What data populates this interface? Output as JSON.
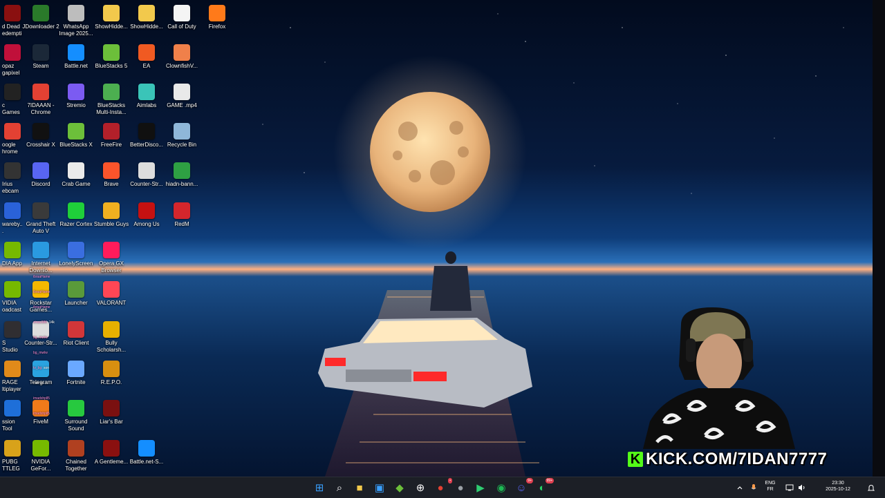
{
  "desktop": {
    "icons": [
      {
        "label": "d Dead edempti...",
        "icon": "rdr-icon",
        "color": "#8a1010"
      },
      {
        "label": "JDownloader 2",
        "icon": "jdownloader-icon",
        "color": "#2a7a2a"
      },
      {
        "label": "WhatsApp Image 2025...",
        "icon": "image-file-icon",
        "color": "#bdbdbd"
      },
      {
        "label": "ShowHidde...",
        "icon": "folder-icon",
        "color": "#f2c94c"
      },
      {
        "label": "ShowHidde...",
        "icon": "folder-icon",
        "color": "#f2c94c"
      },
      {
        "label": "Call of Duty",
        "icon": "file-icon",
        "color": "#f4f4f4"
      },
      {
        "label": "Firefox",
        "icon": "firefox-icon",
        "color": "#ff7a1a"
      },
      {
        "label": "opaz gapixel AI",
        "icon": "topaz-icon",
        "color": "#c0103a"
      },
      {
        "label": "Steam",
        "icon": "steam-icon",
        "color": "#1b2838"
      },
      {
        "label": "Battle.net",
        "icon": "battlenet-icon",
        "color": "#148eff"
      },
      {
        "label": "BlueStacks 5",
        "icon": "bluestacks-icon",
        "color": "#6cbf3a"
      },
      {
        "label": "EA",
        "icon": "ea-icon",
        "color": "#f05a22"
      },
      {
        "label": "ClownfishV...",
        "icon": "clownfish-icon",
        "color": "#f0804a"
      },
      {
        "label": "c Games uncher",
        "icon": "epic-games-icon",
        "color": "#222222"
      },
      {
        "label": "7IDAAAN - Chrome",
        "icon": "chrome-icon",
        "color": "#e34133"
      },
      {
        "label": "Stremio",
        "icon": "stremio-icon",
        "color": "#7b5bf2"
      },
      {
        "label": "BlueStacks Multi-Insta...",
        "icon": "bluestacks-multi-icon",
        "color": "#4caf50"
      },
      {
        "label": "Aimlabs",
        "icon": "aimlabs-icon",
        "color": "#3ac4b8"
      },
      {
        "label": "GAME .mp4",
        "icon": "video-file-icon",
        "color": "#e9e9e9"
      },
      {
        "label": "oogle hrome",
        "icon": "chrome-icon",
        "color": "#e34133"
      },
      {
        "label": "Crosshair X",
        "icon": "crosshair-icon",
        "color": "#111111"
      },
      {
        "label": "BlueStacks X",
        "icon": "bluestacks-icon",
        "color": "#6cbf3a"
      },
      {
        "label": "FreeFire",
        "icon": "freefire-icon",
        "color": "#b3202a"
      },
      {
        "label": "BetterDisco...",
        "icon": "terminal-icon",
        "color": "#101010"
      },
      {
        "label": "Recycle Bin",
        "icon": "recycle-bin-icon",
        "color": "#8fb7d9"
      },
      {
        "label": "Irius ebcam",
        "icon": "camera-icon",
        "color": "#333333"
      },
      {
        "label": "Discord",
        "icon": "discord-icon",
        "color": "#5865f2"
      },
      {
        "label": "Crab Game",
        "icon": "crab-game-icon",
        "color": "#eaeaea"
      },
      {
        "label": "Brave",
        "icon": "brave-icon",
        "color": "#fb542b"
      },
      {
        "label": "Counter-Str...",
        "icon": "counter-strike-icon",
        "color": "#dddddd"
      },
      {
        "label": "hiadn-bann...",
        "icon": "file-icon",
        "color": "#2ea043"
      },
      {
        "label": "wareby...",
        "icon": "app-icon",
        "color": "#2a62d8"
      },
      {
        "label": "Grand Theft Auto V",
        "icon": "gta-icon",
        "color": "#3a3a3a"
      },
      {
        "label": "Razer Cortex",
        "icon": "razer-icon",
        "color": "#1fcf3a"
      },
      {
        "label": "Stumble Guys",
        "icon": "stumble-guys-icon",
        "color": "#f0b020"
      },
      {
        "label": "Among Us",
        "icon": "among-us-icon",
        "color": "#c51111"
      },
      {
        "label": "RedM",
        "icon": "redm-icon",
        "color": "#d4262c"
      },
      {
        "label": "DIA App",
        "icon": "nvidia-icon",
        "color": "#76b900"
      },
      {
        "label": "Internet Downlo...",
        "icon": "idm-icon",
        "color": "#2a9ae0"
      },
      {
        "label": "LonelyScreen",
        "icon": "monitor-icon",
        "color": "#3a6ee0"
      },
      {
        "label": "Opera GX Browser",
        "icon": "opera-gx-icon",
        "color": "#ff1b5b"
      },
      {
        "label": "VIDIA oadcast",
        "icon": "nvidia-icon",
        "color": "#76b900"
      },
      {
        "label": "Rockstar Games...",
        "icon": "rockstar-icon",
        "color": "#f5b800"
      },
      {
        "label": "Launcher",
        "icon": "minecraft-icon",
        "color": "#5a9a3a"
      },
      {
        "label": "VALORANT",
        "icon": "valorant-icon",
        "color": "#ff4655"
      },
      {
        "label": "S Studio",
        "icon": "obs-icon",
        "color": "#302e31"
      },
      {
        "label": "Counter-Str...",
        "icon": "counter-strike-icon",
        "color": "#dddddd"
      },
      {
        "label": "Riot Client",
        "icon": "riot-icon",
        "color": "#d13639"
      },
      {
        "label": "Bully Scholarsh...",
        "icon": "bully-icon",
        "color": "#e6b000"
      },
      {
        "label": "RAGE ltiplayer",
        "icon": "ragemp-icon",
        "color": "#e08a1a"
      },
      {
        "label": "Telegram",
        "icon": "telegram-icon",
        "color": "#2aa3e0"
      },
      {
        "label": "Fortnite",
        "icon": "fortnite-icon",
        "color": "#6aa8ff"
      },
      {
        "label": "R.E.P.O.",
        "icon": "repo-icon",
        "color": "#d88f10"
      },
      {
        "label": "ssion Tool",
        "icon": "tool-icon",
        "color": "#1e6fd9"
      },
      {
        "label": "FiveM",
        "icon": "fivem-icon",
        "color": "#f07a1a"
      },
      {
        "label": "Surround Sound",
        "icon": "surround-sound-icon",
        "color": "#27c93f"
      },
      {
        "label": "Liar's Bar",
        "icon": "liars-bar-icon",
        "color": "#7a1010"
      },
      {
        "label": "PUBG TTLEGR...",
        "icon": "pubg-icon",
        "color": "#d8a21a"
      },
      {
        "label": "NVIDIA GeFor...",
        "icon": "nvidia-icon",
        "color": "#76b900"
      },
      {
        "label": "Chained Together",
        "icon": "chained-together-icon",
        "color": "#b04020"
      },
      {
        "label": "A Gentleme...",
        "icon": "gentleman-icon",
        "color": "#8a1010"
      },
      {
        "label": "Battle.net-S...",
        "icon": "battlenet-icon",
        "color": "#148eff"
      }
    ]
  },
  "chat": [
    {
      "user": "ibraaHame",
      "text": ""
    },
    {
      "user": "ibraaHame",
      "text": ""
    },
    {
      "user": "ibraaHame",
      "text": ""
    },
    {
      "user": "zinax386",
      "text": ": 14k"
    },
    {
      "user": "bg_mwlw",
      "text": ""
    },
    {
      "user": "bg_mwlw",
      "text": ""
    },
    {
      "user": "tv_bg",
      "text": ": son"
    },
    {
      "user": "",
      "text": ": ah bo..."
    },
    {
      "user": "imadxhpll5",
      "text": ""
    },
    {
      "user": "imadxhpll5",
      "text": ""
    }
  ],
  "stream": {
    "overlay_text": "KICK.COM/7IDAN7777",
    "logo_letter": "K"
  },
  "taskbar": {
    "apps": [
      {
        "icon": "windows-start-icon",
        "color": "#3aa0ff"
      },
      {
        "icon": "search-icon",
        "color": "#ffffff"
      },
      {
        "icon": "file-explorer-icon",
        "color": "#f2c94c"
      },
      {
        "icon": "microsoft-store-icon",
        "color": "#3aa0ff"
      },
      {
        "icon": "bluestacks-icon",
        "color": "#6cbf3a"
      },
      {
        "icon": "crosshair-icon",
        "color": "#ffffff"
      },
      {
        "icon": "chrome-icon",
        "color": "#e34133"
      },
      {
        "icon": "chrome-icon",
        "color": "#9aa0a6"
      },
      {
        "icon": "play-icon",
        "color": "#2ecc71"
      },
      {
        "icon": "spotify-icon",
        "color": "#1db954"
      },
      {
        "icon": "discord-icon",
        "color": "#5865f2"
      },
      {
        "icon": "whatsapp-icon",
        "color": "#25d366"
      }
    ],
    "badges": {
      "chrome": "•",
      "discord": "9+",
      "whatsapp": "99+"
    },
    "tray": {
      "lang_top": "ENG",
      "lang_bottom": "FR",
      "time": "23:30",
      "date": "2025-10-12"
    }
  }
}
